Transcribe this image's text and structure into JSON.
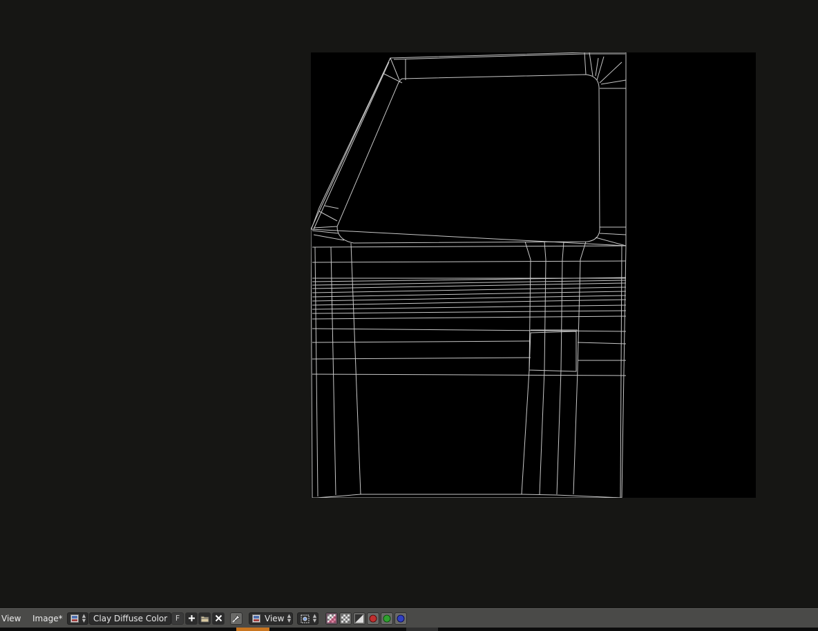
{
  "editor": {
    "menus": {
      "view": "View",
      "image": "Image*"
    },
    "image_name": "Clay Diffuse Color",
    "fake_user_label": "F",
    "draw_mode": "View",
    "icons": {
      "editor_type": "image-editor-icon",
      "image_browse": "image-browse-icon",
      "new_image": "plus-icon",
      "open_image": "folder-open-icon",
      "unlink": "close-icon",
      "pin": "pin-icon",
      "mode": "view-mode-icon",
      "pivot": "pivot-icon",
      "display_color_alpha": "color-alpha-icon",
      "display_alpha": "checker-icon",
      "display_z": "z-buffer-icon",
      "channel_red": "red-channel-icon",
      "channel_green": "green-channel-icon",
      "channel_blue": "blue-channel-icon"
    },
    "colors": {
      "background": "#161614",
      "canvas": "#000000",
      "wire": "#c8c8c8",
      "header": "#4a4a48",
      "timeline_accent": "#c87520"
    }
  }
}
